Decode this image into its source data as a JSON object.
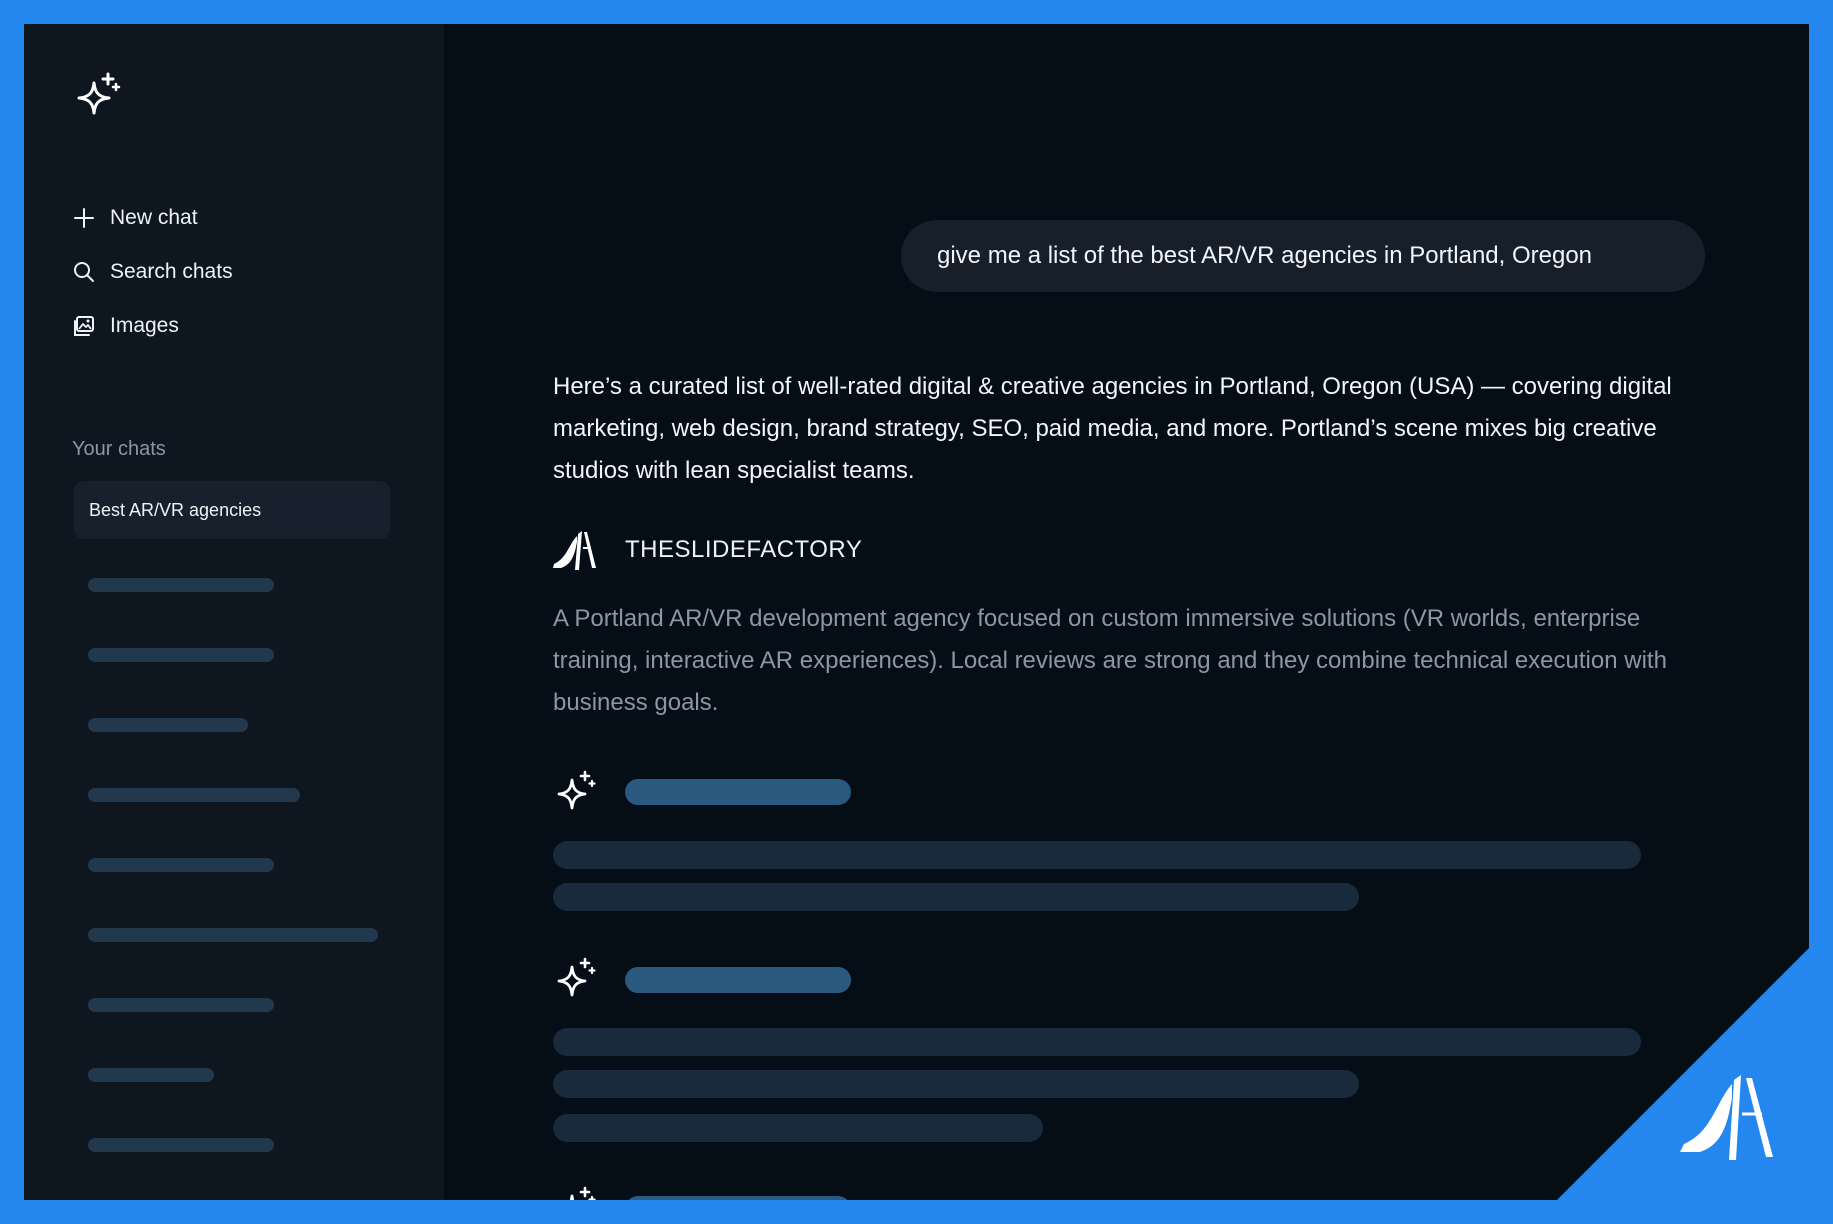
{
  "sidebar": {
    "nav": [
      {
        "label": "New chat",
        "icon": "plus-icon"
      },
      {
        "label": "Search chats",
        "icon": "search-icon"
      },
      {
        "label": "Images",
        "icon": "images-icon"
      }
    ],
    "section_label": "Your chats",
    "active_chat": "Best AR/VR agencies"
  },
  "conversation": {
    "user_message": "give me a list of the best AR/VR agencies in Portland, Oregon",
    "intro": "Here’s a curated list of well-rated digital & creative agencies in Portland, Oregon (USA) — covering digital marketing, web design, brand strategy, SEO, paid media, and more. Portland’s scene mixes big creative studios with lean specialist teams.",
    "agency": {
      "name": "THESLIDEFACTORY",
      "description": "A Portland AR/VR development agency focused on custom immersive solutions (VR worlds, enterprise training, interactive AR experiences). Local reviews are strong and they combine technical execution with business goals."
    }
  },
  "colors": {
    "frame": "#2487ef",
    "background": "#050d16",
    "sidebar": "#0e1620",
    "skeleton_title": "#2b5a80",
    "skeleton_line": "#182a3c"
  }
}
